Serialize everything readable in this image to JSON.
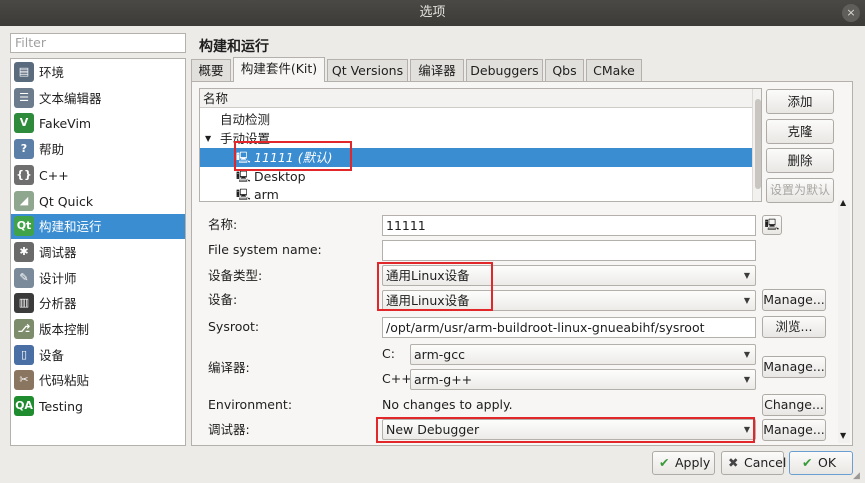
{
  "window": {
    "title": "选项",
    "close_icon": "×"
  },
  "filter": {
    "placeholder": "Filter"
  },
  "sidebar": {
    "items": [
      {
        "label": "环境",
        "icon": "monitor-icon",
        "glyph": "▤",
        "color": "#5a6b7d"
      },
      {
        "label": "文本编辑器",
        "icon": "text-editor-icon",
        "glyph": "☰",
        "color": "#6c7c8c"
      },
      {
        "label": "FakeVim",
        "icon": "fakevim-icon",
        "glyph": "V",
        "color": "#2f8b3c"
      },
      {
        "label": "帮助",
        "icon": "help-icon",
        "glyph": "?",
        "color": "#5b7fa6"
      },
      {
        "label": "C++",
        "icon": "cpp-icon",
        "glyph": "{}",
        "color": "#6f6f6f"
      },
      {
        "label": "Qt Quick",
        "icon": "qt-quick-icon",
        "glyph": "◢",
        "color": "#8fa68f"
      },
      {
        "label": "构建和运行",
        "icon": "build-run-icon",
        "glyph": "Qt",
        "color": "#41a349"
      },
      {
        "label": "调试器",
        "icon": "debugger-icon",
        "glyph": "✱",
        "color": "#6a6a6a"
      },
      {
        "label": "设计师",
        "icon": "designer-icon",
        "glyph": "✎",
        "color": "#7a8a9a"
      },
      {
        "label": "分析器",
        "icon": "analyzer-icon",
        "glyph": "▥",
        "color": "#3b3b3b"
      },
      {
        "label": "版本控制",
        "icon": "version-control-icon",
        "glyph": "⎇",
        "color": "#7d8c6a"
      },
      {
        "label": "设备",
        "icon": "devices-icon",
        "glyph": "▯",
        "color": "#4a6fa5"
      },
      {
        "label": "代码粘贴",
        "icon": "code-paste-icon",
        "glyph": "✂",
        "color": "#8a7560"
      },
      {
        "label": "Testing",
        "icon": "testing-icon",
        "glyph": "QA",
        "color": "#1e8c2f"
      }
    ],
    "selected_index": 6
  },
  "page_title": "构建和运行",
  "tabs": [
    "概要",
    "构建套件(Kit)",
    "Qt Versions",
    "编译器",
    "Debuggers",
    "Qbs",
    "CMake"
  ],
  "active_tab": 1,
  "kits": {
    "header": "名称",
    "auto_detected": "自动检测",
    "manual": "手动设置",
    "items": [
      "11111 (默认)",
      "Desktop",
      "arm"
    ]
  },
  "kit_buttons": {
    "add": "添加",
    "clone": "克隆",
    "remove": "删除",
    "make_default": "设置为默认"
  },
  "form": {
    "name_label": "名称:",
    "name_value": "11111",
    "fs_label": "File system name:",
    "fs_value": "",
    "device_type_label": "设备类型:",
    "device_type_value": "通用Linux设备",
    "device_label": "设备:",
    "device_value": "通用Linux设备",
    "device_manage": "Manage...",
    "sysroot_label": "Sysroot:",
    "sysroot_value": "/opt/arm/usr/arm-buildroot-linux-gnueabihf/sysroot",
    "sysroot_browse": "浏览...",
    "compiler_label": "编译器:",
    "c_label": "C:",
    "c_value": "arm-gcc",
    "cpp_label": "C++:",
    "cpp_value": "arm-g++",
    "compiler_manage": "Manage...",
    "env_label": "Environment:",
    "env_value": "No changes to apply.",
    "env_change": "Change...",
    "debugger_label": "调试器:",
    "debugger_value": "New Debugger",
    "debugger_manage": "Manage..."
  },
  "dialog_buttons": {
    "apply": "Apply",
    "cancel": "Cancel",
    "ok": "OK"
  }
}
